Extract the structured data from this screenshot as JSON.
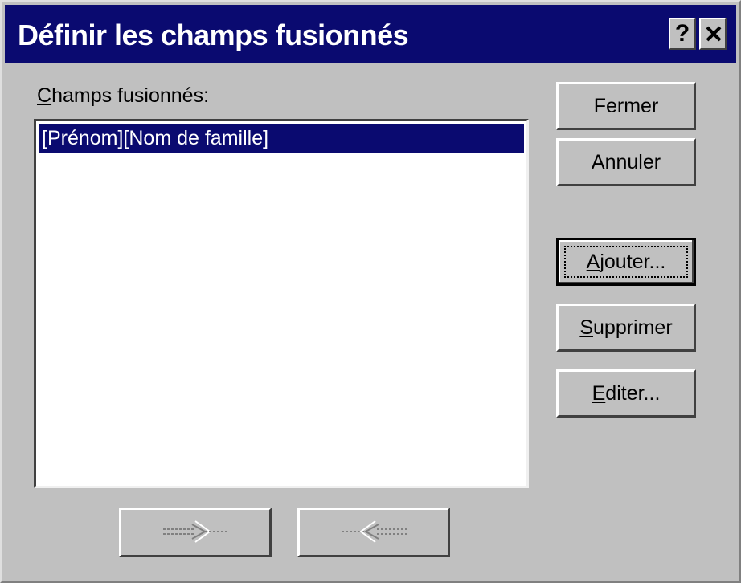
{
  "window": {
    "title": "Définir les champs fusionnés",
    "help_label": "?"
  },
  "field": {
    "label_mnemonic": "C",
    "label_rest": "hamps fusionnés:",
    "items": [
      "[Prénom][Nom de famille]"
    ]
  },
  "buttons": {
    "close": {
      "label": "Fermer"
    },
    "cancel": {
      "label": "Annuler"
    },
    "add": {
      "mnemonic": "A",
      "rest": "jouter..."
    },
    "delete": {
      "mnemonic": "S",
      "rest": "upprimer"
    },
    "edit": {
      "mnemonic": "E",
      "rest": "diter..."
    }
  },
  "arrow_buttons": {
    "move_in": {
      "icon": "arrow-right-icon",
      "enabled": false
    },
    "move_out": {
      "icon": "arrow-left-icon",
      "enabled": false
    }
  }
}
